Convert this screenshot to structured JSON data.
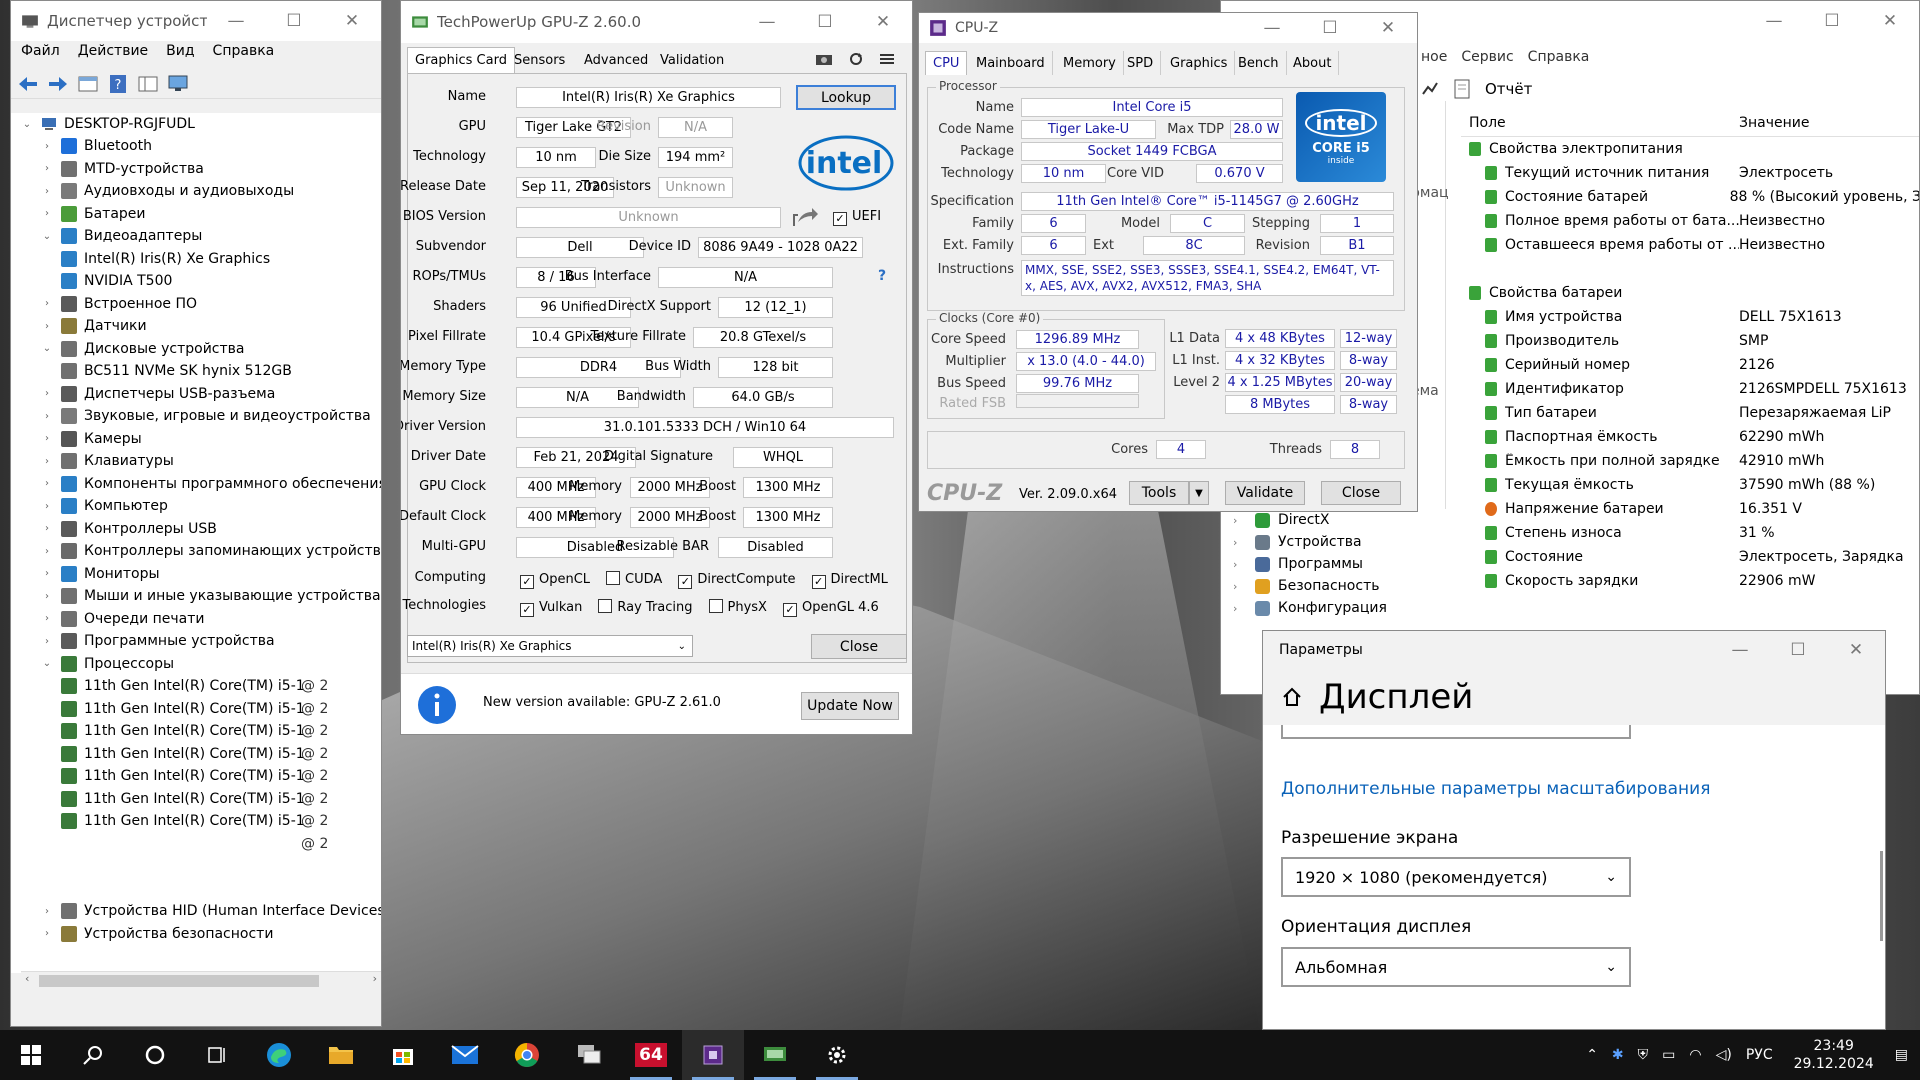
{
  "devmgr": {
    "title": "Диспетчер устройств",
    "menu": [
      "Файл",
      "Действие",
      "Вид",
      "Справка"
    ],
    "root": "DESKTOP-RGJFUDL",
    "items": [
      {
        "label": "Bluetooth",
        "depth": 1,
        "exp": "›",
        "icon": "bluetooth-icon",
        "color": "#1e6fd9"
      },
      {
        "label": "MTD-устройства",
        "depth": 1,
        "exp": "›",
        "icon": "mtd-icon",
        "color": "#707070"
      },
      {
        "label": "Аудиовходы и аудиовыходы",
        "depth": 1,
        "exp": "›",
        "icon": "audio-io-icon",
        "color": "#7a7a7a"
      },
      {
        "label": "Батареи",
        "depth": 1,
        "exp": "›",
        "icon": "battery-icon",
        "color": "#4b9c3a"
      },
      {
        "label": "Видеоадаптеры",
        "depth": 1,
        "exp": "⌄",
        "icon": "display-adapter-icon",
        "color": "#2a7fc6"
      },
      {
        "label": "Intel(R) Iris(R) Xe Graphics",
        "depth": 2,
        "exp": "",
        "icon": "gpu-icon",
        "color": "#2a7fc6"
      },
      {
        "label": "NVIDIA T500",
        "depth": 2,
        "exp": "",
        "icon": "gpu-icon",
        "color": "#2a7fc6"
      },
      {
        "label": "Встроенное ПО",
        "depth": 1,
        "exp": "›",
        "icon": "firmware-icon",
        "color": "#5a5a5a"
      },
      {
        "label": "Датчики",
        "depth": 1,
        "exp": "›",
        "icon": "sensor-icon",
        "color": "#8a7a3a"
      },
      {
        "label": "Дисковые устройства",
        "depth": 1,
        "exp": "⌄",
        "icon": "disk-icon",
        "color": "#707070"
      },
      {
        "label": "BC511 NVMe SK hynix 512GB",
        "depth": 2,
        "exp": "",
        "icon": "disk-icon",
        "color": "#707070"
      },
      {
        "label": "Диспетчеры USB-разъема",
        "depth": 1,
        "exp": "›",
        "icon": "usb-icon",
        "color": "#5a5a5a"
      },
      {
        "label": "Звуковые, игровые и видеоустройства",
        "depth": 1,
        "exp": "›",
        "icon": "sound-icon",
        "color": "#7a7a7a"
      },
      {
        "label": "Камеры",
        "depth": 1,
        "exp": "›",
        "icon": "camera-icon",
        "color": "#555555"
      },
      {
        "label": "Клавиатуры",
        "depth": 1,
        "exp": "›",
        "icon": "keyboard-icon",
        "color": "#707070"
      },
      {
        "label": "Компоненты программного обеспечения",
        "depth": 1,
        "exp": "›",
        "icon": "software-component-icon",
        "color": "#2a7fc6"
      },
      {
        "label": "Компьютер",
        "depth": 1,
        "exp": "›",
        "icon": "computer-icon",
        "color": "#2a7fc6"
      },
      {
        "label": "Контроллеры USB",
        "depth": 1,
        "exp": "›",
        "icon": "usb-controller-icon",
        "color": "#5a5a5a"
      },
      {
        "label": "Контроллеры запоминающих устройств",
        "depth": 1,
        "exp": "›",
        "icon": "storage-controller-icon",
        "color": "#6a6a6a"
      },
      {
        "label": "Мониторы",
        "depth": 1,
        "exp": "›",
        "icon": "monitor-icon",
        "color": "#2a7fc6"
      },
      {
        "label": "Мыши и иные указывающие устройства",
        "depth": 1,
        "exp": "›",
        "icon": "mouse-icon",
        "color": "#707070"
      },
      {
        "label": "Очереди печати",
        "depth": 1,
        "exp": "›",
        "icon": "printer-icon",
        "color": "#707070"
      },
      {
        "label": "Программные устройства",
        "depth": 1,
        "exp": "›",
        "icon": "software-device-icon",
        "color": "#5a5a5a"
      },
      {
        "label": "Процессоры",
        "depth": 1,
        "exp": "⌄",
        "icon": "cpu-icon",
        "color": "#3a7a3a"
      },
      {
        "label": "11th Gen Intel(R) Core(TM) i5-1",
        "depth": 2,
        "exp": "",
        "icon": "cpu-icon",
        "color": "#3a7a3a",
        "tail": "@ 2"
      },
      {
        "label": "11th Gen Intel(R) Core(TM) i5-1",
        "depth": 2,
        "exp": "",
        "icon": "cpu-icon",
        "color": "#3a7a3a",
        "tail": "@ 2"
      },
      {
        "label": "11th Gen Intel(R) Core(TM) i5-1",
        "depth": 2,
        "exp": "",
        "icon": "cpu-icon",
        "color": "#3a7a3a",
        "tail": "@ 2"
      },
      {
        "label": "11th Gen Intel(R) Core(TM) i5-1",
        "depth": 2,
        "exp": "",
        "icon": "cpu-icon",
        "color": "#3a7a3a",
        "tail": "@ 2"
      },
      {
        "label": "11th Gen Intel(R) Core(TM) i5-1",
        "depth": 2,
        "exp": "",
        "icon": "cpu-icon",
        "color": "#3a7a3a",
        "tail": "@ 2"
      },
      {
        "label": "11th Gen Intel(R) Core(TM) i5-1",
        "depth": 2,
        "exp": "",
        "icon": "cpu-icon",
        "color": "#3a7a3a",
        "tail": "@ 2"
      },
      {
        "label": "11th Gen Intel(R) Core(TM) i5-1",
        "depth": 2,
        "exp": "",
        "icon": "cpu-icon",
        "color": "#3a7a3a",
        "tail": "@ 2"
      },
      {
        "label": "",
        "depth": 2,
        "exp": "",
        "icon": "",
        "color": "",
        "tail": "@ 2"
      },
      {
        "label": "",
        "depth": 1,
        "exp": "",
        "icon": "",
        "color": ""
      },
      {
        "label": "",
        "depth": 1,
        "exp": "",
        "icon": "",
        "color": ""
      },
      {
        "label": "Устройства HID (Human Interface Devices)",
        "depth": 1,
        "exp": "›",
        "icon": "hid-icon",
        "color": "#707070"
      },
      {
        "label": "Устройства безопасности",
        "depth": 1,
        "exp": "›",
        "icon": "security-device-icon",
        "color": "#8a7a3a"
      }
    ]
  },
  "gpuz": {
    "title": "TechPowerUp GPU-Z 2.60.0",
    "tabs": [
      "Graphics Card",
      "Sensors",
      "Advanced",
      "Validation"
    ],
    "lookup": "Lookup",
    "logo": "intel",
    "rows": {
      "name_l": "Name",
      "name": "Intel(R) Iris(R) Xe Graphics",
      "gpu_l": "GPU",
      "gpu": "Tiger Lake GT2",
      "rev_l": "Revision",
      "rev": "N/A",
      "tech_l": "Technology",
      "tech": "10 nm",
      "die_l": "Die Size",
      "die": "194 mm²",
      "rel_l": "Release Date",
      "rel": "Sep 11, 2020",
      "trans_l": "Transistors",
      "trans": "Unknown",
      "bios_l": "BIOS Version",
      "bios": "Unknown",
      "uefi": "UEFI",
      "sub_l": "Subvendor",
      "sub": "Dell",
      "devid_l": "Device ID",
      "devid": "8086 9A49 - 1028 0A22",
      "rops_l": "ROPs/TMUs",
      "rops": "8 / 16",
      "bus_l": "Bus Interface",
      "bus": "N/A",
      "q": "?",
      "shad_l": "Shaders",
      "shad": "96 Unified",
      "dx_l": "DirectX Support",
      "dx": "12 (12_1)",
      "pix_l": "Pixel Fillrate",
      "pix": "10.4 GPixel/s",
      "tex_l": "Texture Fillrate",
      "tex": "20.8 GTexel/s",
      "mt_l": "Memory Type",
      "mt": "DDR4",
      "bw_l": "Bus Width",
      "bw": "128 bit",
      "ms_l": "Memory Size",
      "ms": "N/A",
      "band_l": "Bandwidth",
      "band": "64.0 GB/s",
      "drv_l": "Driver Version",
      "drv": "31.0.101.5333 DCH / Win10 64",
      "dd_l": "Driver Date",
      "dd": "Feb 21, 2024",
      "sig_l": "Digital Signature",
      "sig": "WHQL",
      "gc_l": "GPU Clock",
      "gc": "400 MHz",
      "mem_l": "Memory",
      "gcm": "2000 MHz",
      "boost_l": "Boost",
      "gcb": "1300 MHz",
      "dc_l": "Default Clock",
      "dc": "400 MHz",
      "dcm": "2000 MHz",
      "dcb": "1300 MHz",
      "mg_l": "Multi-GPU",
      "mg": "Disabled",
      "rb_l": "Resizable BAR",
      "rb": "Disabled",
      "comp_l": "Computing",
      "tech2_l": "Technologies"
    },
    "computing": [
      "OpenCL",
      "CUDA",
      "DirectCompute",
      "DirectML"
    ],
    "computing_on": [
      true,
      false,
      true,
      true
    ],
    "technologies": [
      "Vulkan",
      "Ray Tracing",
      "PhysX",
      "OpenGL 4.6"
    ],
    "technologies_on": [
      true,
      false,
      false,
      true
    ],
    "select": "Intel(R) Iris(R) Xe Graphics",
    "close": "Close",
    "update_msg": "New version available: GPU-Z 2.61.0",
    "update_btn": "Update Now"
  },
  "cpuz": {
    "title": "CPU-Z",
    "tabs": [
      "CPU",
      "Mainboard",
      "Memory",
      "SPD",
      "Graphics",
      "Bench",
      "About"
    ],
    "proc_group": "Processor",
    "name_l": "Name",
    "name": "Intel Core i5",
    "code_l": "Code Name",
    "code": "Tiger Lake-U",
    "tdp_l": "Max TDP",
    "tdp": "28.0 W",
    "pkg_l": "Package",
    "pkg": "Socket 1449 FCBGA",
    "tech_l": "Technology",
    "tech": "10 nm",
    "vid_l": "Core VID",
    "vid": "0.670 V",
    "spec_l": "Specification",
    "spec": "11th Gen Intel® Core™ i5-1145G7 @ 2.60GHz",
    "fam_l": "Family",
    "fam": "6",
    "model_l": "Model",
    "model": "C",
    "step_l": "Stepping",
    "step": "1",
    "exf_l": "Ext. Family",
    "exf": "6",
    "exm_l": "Ext",
    "exm": "8C",
    "rev_l": "Revision",
    "rev": "B1",
    "ins_l": "Instructions",
    "ins": "MMX, SSE, SSE2, SSE3, SSSE3, SSE4.1, SSE4.2, EM64T, VT-x, AES, AVX, AVX2, AVX512, FMA3, SHA",
    "clk_group": "Clocks (Core #0)",
    "cs_l": "Core Speed",
    "cs": "1296.89 MHz",
    "mul_l": "Multiplier",
    "mul": "x 13.0 (4.0 - 44.0)",
    "bs_l": "Bus Speed",
    "bs": "99.76 MHz",
    "fsb_l": "Rated FSB",
    "l1d_l": "L1 Data",
    "l1d": "4 x 48 KBytes",
    "l1dw": "12-way",
    "l1i_l": "L1 Inst.",
    "l1i": "4 x 32 KBytes",
    "l1iw": "8-way",
    "l2_l": "Level 2",
    "l2": "4 x 1.25 MBytes",
    "l2w": "20-way",
    "l3": "8 MBytes",
    "l3w": "8-way",
    "cores_l": "Cores",
    "cores": "4",
    "thr_l": "Threads",
    "thr": "8",
    "brand": "CPU-Z",
    "ver": "Ver. 2.09.0.x64",
    "tools": "Tools",
    "validate": "Validate",
    "close": "Close",
    "badge1": "intel",
    "badge2": "CORE i5",
    "badge3": "inside"
  },
  "aida": {
    "menu": [
      "ное",
      "Сервис",
      "Справка"
    ],
    "report": "Отчёт",
    "col_field": "Поле",
    "col_value": "Значение",
    "left_frag": [
      "рмац",
      "ема"
    ],
    "sections": [
      {
        "title": "Свойства электропитания",
        "rows": [
          [
            "Текущий источник питания",
            "Электросеть"
          ],
          [
            "Состояние батарей",
            "88 % (Высокий уровень, З"
          ],
          [
            "Полное время работы от бата...",
            "Неизвестно"
          ],
          [
            "Оставшееся время работы от ...",
            "Неизвестно"
          ]
        ]
      },
      {
        "title": "Свойства батареи",
        "rows": [
          [
            "Имя устройства",
            "DELL 75X1613"
          ],
          [
            "Производитель",
            "SMP"
          ],
          [
            "Серийный номер",
            "2126"
          ],
          [
            "Идентификатор",
            "2126SMPDELL 75X1613"
          ],
          [
            "Тип батареи",
            "Перезаряжаемая LiP"
          ],
          [
            "Паспортная ёмкость",
            "62290 mWh"
          ],
          [
            "Ёмкость при полной зарядке",
            "42910 mWh"
          ],
          [
            "Текущая ёмкость",
            "37590 mWh  (88 %)"
          ],
          [
            "Напряжение батареи",
            "16.351 V"
          ],
          [
            "Степень износа",
            "31 %"
          ],
          [
            "Состояние",
            "Электросеть, Зарядка"
          ],
          [
            "Скорость зарядки",
            "22906 mW"
          ]
        ]
      }
    ],
    "tree": [
      "DirectX",
      "Устройства",
      "Программы",
      "Безопасность",
      "Конфигурация"
    ]
  },
  "settings": {
    "title": "Параметры",
    "heading": "Дисплей",
    "link": "Дополнительные параметры масштабирования",
    "res_label": "Разрешение экрана",
    "res_value": "1920 × 1080 (рекомендуется)",
    "orient_label": "Ориентация дисплея",
    "orient_value": "Альбомная"
  },
  "taskbar": {
    "lang": "РУС",
    "time": "23:49",
    "date": "29.12.2024",
    "aida_label": "64"
  }
}
